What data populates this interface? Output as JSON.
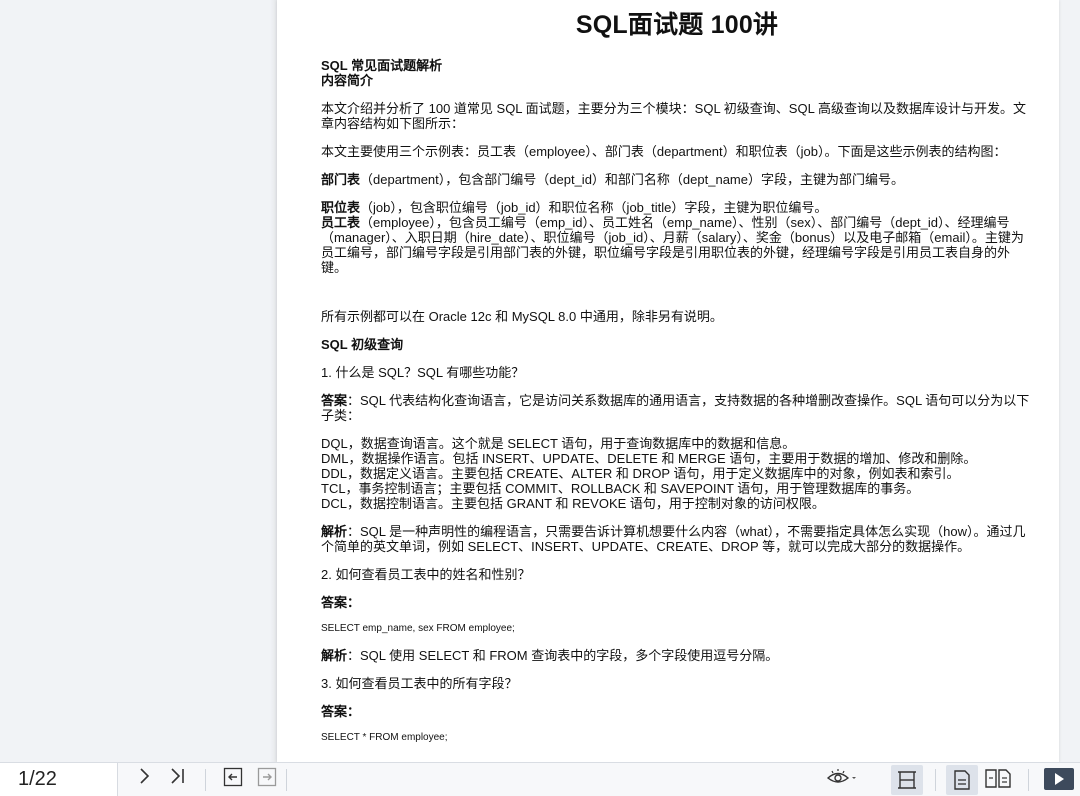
{
  "document": {
    "title": "SQL面试题 100讲",
    "heading_main": "SQL 常见面试题解析",
    "heading_intro": "内容简介",
    "intro_p1": "本文介绍并分析了 100 道常见 SQL 面试题，主要分为三个模块：SQL 初级查询、SQL 高级查询以及数据库设计与开发。文章内容结构如下图所示：",
    "intro_p2": "本文主要使用三个示例表：员工表（employee）、部门表（department）和职位表（job）。下面是这些示例表的结构图：",
    "dept_label": "部门表",
    "dept_text": "（department），包含部门编号（dept_id）和部门名称（dept_name）字段，主键为部门编号。",
    "job_label": "职位表",
    "job_text": "（job），包含职位编号（job_id）和职位名称（job_title）字段，主键为职位编号。",
    "emp_label": "员工表",
    "emp_text": "（employee），包含员工编号（emp_id）、员工姓名（emp_name）、性别（sex）、部门编号（dept_id）、经理编号（manager）、入职日期（hire_date）、职位编号（job_id）、月薪（salary）、奖金（bonus）以及电子邮箱（email）。主键为员工编号，部门编号字段是引用部门表的外键，职位编号字段是引用职位表的外键，经理编号字段是引用员工表自身的外键。",
    "compat": "所有示例都可以在 Oracle 12c 和 MySQL 8.0 中通用，除非另有说明。",
    "section_basic": "SQL 初级查询",
    "q1": "1. 什么是 SQL？SQL 有哪些功能？",
    "answer_label": "答案",
    "q1_answer": "：SQL 代表结构化查询语言，它是访问关系数据库的通用语言，支持数据的各种增删改查操作。SQL 语句可以分为以下子类：",
    "q1_list": [
      "DQL，数据查询语言。这个就是 SELECT 语句，用于查询数据库中的数据和信息。",
      "DML，数据操作语言。包括 INSERT、UPDATE、DELETE 和 MERGE 语句，主要用于数据的增加、修改和删除。",
      "DDL，数据定义语言。主要包括 CREATE、ALTER 和 DROP 语句，用于定义数据库中的对象，例如表和索引。",
      "TCL，事务控制语言；主要包括 COMMIT、ROLLBACK 和 SAVEPOINT 语句，用于管理数据库的事务。",
      "DCL，数据控制语言。主要包括 GRANT 和 REVOKE 语句，用于控制对象的访问权限。"
    ],
    "analysis_label": "解析",
    "q1_analysis": "：SQL 是一种声明性的编程语言，只需要告诉计算机想要什么内容（what），不需要指定具体怎么实现（how）。通过几个简单的英文单词，例如 SELECT、INSERT、UPDATE、CREATE、DROP 等，就可以完成大部分的数据操作。",
    "q2": "2. 如何查看员工表中的姓名和性别？",
    "answer_colon": "：",
    "q2_code": "SELECT emp_name, sex FROM employee;",
    "q2_analysis": "：SQL 使用 SELECT 和 FROM 查询表中的字段，多个字段使用逗号分隔。",
    "q3": "3. 如何查看员工表中的所有字段？",
    "q3_code": "SELECT * FROM employee;"
  },
  "toolbar": {
    "page_indicator": "1/22",
    "icons": [
      "next-page-icon",
      "last-page-icon",
      "back-icon",
      "forward-icon",
      "eye-icon",
      "fit-width-icon",
      "single-page-icon",
      "two-page-icon",
      "play-icon"
    ]
  }
}
